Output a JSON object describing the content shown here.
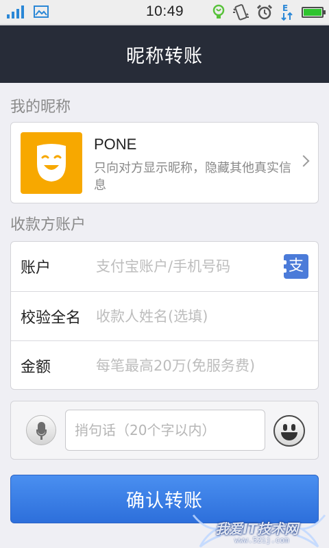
{
  "status_bar": {
    "time": "10:49",
    "signal_level": 4,
    "battery_percent": 100,
    "icons": [
      "signal-icon",
      "picture-icon",
      "lightbulb-icon",
      "vibrate-icon",
      "alarm-icon",
      "data-transfer-icon",
      "battery-icon"
    ]
  },
  "header": {
    "title": "昵称转账"
  },
  "nickname_section": {
    "label": "我的昵称",
    "nickname": "PONE",
    "description": "只向对方显示昵称，隐藏其他真实信息",
    "avatar_color": "#f7a800"
  },
  "payee_section": {
    "label": "收款方账户",
    "account": {
      "label": "账户",
      "placeholder": "支付宝账户/手机号码",
      "value": ""
    },
    "full_name": {
      "label": "校验全名",
      "placeholder": "收款人姓名(选填)",
      "value": ""
    },
    "amount": {
      "label": "金额",
      "placeholder": "每笔最高20万(免服务费)",
      "value": ""
    },
    "contacts_icon_text": "支"
  },
  "message": {
    "placeholder": "捎句话（20个字以内）",
    "value": ""
  },
  "confirm_button": {
    "label": "确认转账",
    "color": "#3a7fe6"
  },
  "watermark": {
    "text": "我爱IT技术网",
    "url": "www.52ij.com"
  }
}
